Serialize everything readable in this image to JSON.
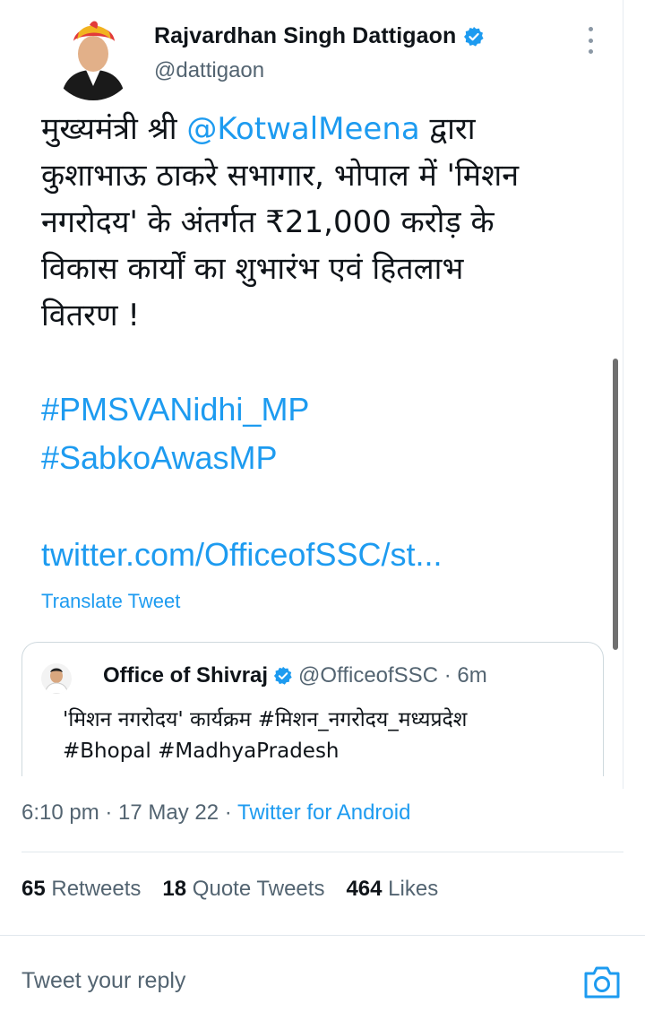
{
  "author": {
    "name": "Rajvardhan Singh Dattigaon",
    "handle": "@dattigaon"
  },
  "tweet": {
    "line1_pre": "मुख्यमंत्री श्री ",
    "mention": "@KotwalMeena",
    "line1_post": " द्वारा",
    "line2": "कुशाभाऊ ठाकरे सभागार, भोपाल में 'मिशन",
    "line3": "नगरोदय' के अंतर्गत ₹21,000 करोड़ के",
    "line4": "विकास कार्यों का शुभारंभ एवं हितलाभ",
    "line5": "वितरण !",
    "hashtag1": "#PMSVANidhi_MP",
    "hashtag2": "#SabkoAwasMP",
    "url": "twitter.com/OfficeofSSC/st...",
    "translate": "Translate Tweet"
  },
  "quoted": {
    "name": "Office of Shivraj",
    "meta": "@OfficeofSSC · 6m",
    "line1": "'मिशन नगरोदय' कार्यक्रम #मिशन_नगरोदय_मध्यप्रदेश",
    "line2": "#Bhopal #MadhyaPradesh"
  },
  "meta": {
    "time": "6:10 pm · 17 May 22 · ",
    "source": "Twitter for Android"
  },
  "stats": {
    "retweets_count": "65",
    "retweets_label": "Retweets",
    "quotes_count": "18",
    "quotes_label": "Quote Tweets",
    "likes_count": "464",
    "likes_label": "Likes"
  },
  "reply": {
    "placeholder": "Tweet your reply"
  },
  "colors": {
    "accent": "#1d9bf0",
    "muted": "#536471"
  }
}
